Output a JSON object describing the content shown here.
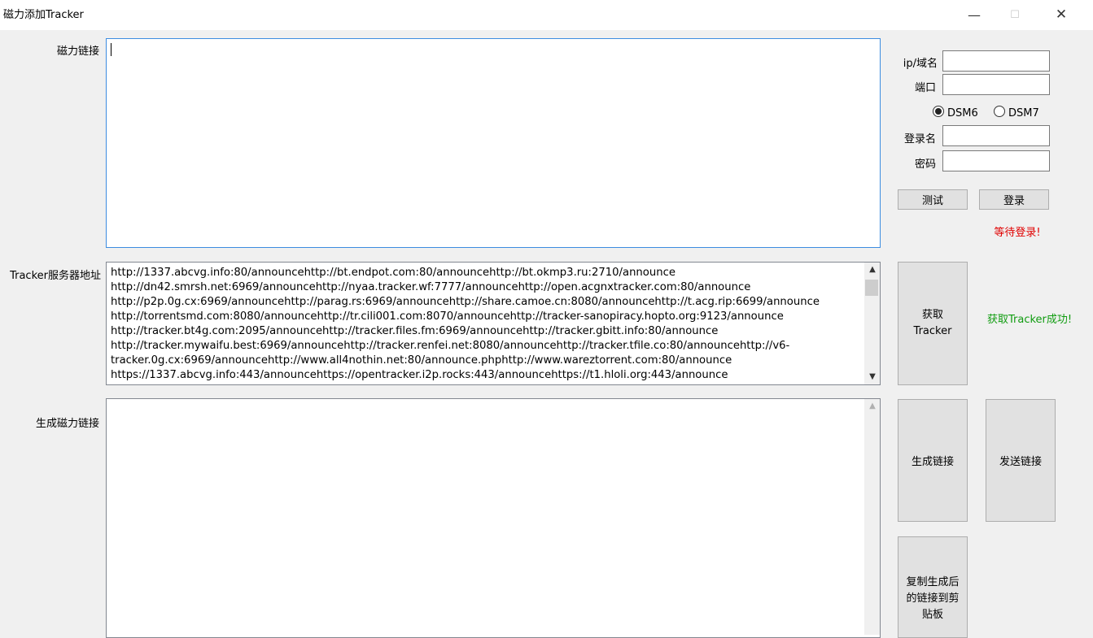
{
  "window": {
    "title": "磁力添加Tracker",
    "minimize": "—",
    "maximize": "☐",
    "close": "✕"
  },
  "magnet": {
    "label": "磁力链接",
    "value": ""
  },
  "tracker": {
    "label": "Tracker服务器地址",
    "text": "http://1337.abcvg.info:80/announcehttp://bt.endpot.com:80/announcehttp://bt.okmp3.ru:2710/announce\nhttp://dn42.smrsh.net:6969/announcehttp://nyaa.tracker.wf:7777/announcehttp://open.acgnxtracker.com:80/announce\nhttp://p2p.0g.cx:6969/announcehttp://parag.rs:6969/announcehttp://share.camoe.cn:8080/announcehttp://t.acg.rip:6699/announce\nhttp://torrentsmd.com:8080/announcehttp://tr.cili001.com:8070/announcehttp://tracker-sanopiracy.hopto.org:9123/announce\nhttp://tracker.bt4g.com:2095/announcehttp://tracker.files.fm:6969/announcehttp://tracker.gbitt.info:80/announce\nhttp://tracker.mywaifu.best:6969/announcehttp://tracker.renfei.net:8080/announcehttp://tracker.tfile.co:80/announcehttp://v6-\ntracker.0g.cx:6969/announcehttp://www.all4nothin.net:80/announce.phphttp://www.wareztorrent.com:80/announce\nhttps://1337.abcvg.info:443/announcehttps://opentracker.i2p.rocks:443/announcehttps://t1.hloli.org:443/announce"
  },
  "generated": {
    "label": "生成磁力链接",
    "value": ""
  },
  "connection": {
    "ip_label": "ip/域名",
    "ip_value": "",
    "port_label": "端口",
    "port_value": "",
    "dsm6_label": "DSM6",
    "dsm7_label": "DSM7",
    "selected": "DSM6",
    "login_label": "登录名",
    "login_value": "",
    "password_label": "密码",
    "password_value": ""
  },
  "buttons": {
    "test": "测试",
    "login": "登录",
    "get_tracker": "获取\nTracker",
    "generate": "生成链接",
    "send": "发送链接",
    "copy": "复制生成后\n的链接到剪\n贴板"
  },
  "status": {
    "login": "等待登录!",
    "tracker": "获取Tracker成功!"
  },
  "colors": {
    "login_status": "#e00000",
    "tracker_status": "#109c10",
    "focus_border": "#3c8ce0"
  }
}
